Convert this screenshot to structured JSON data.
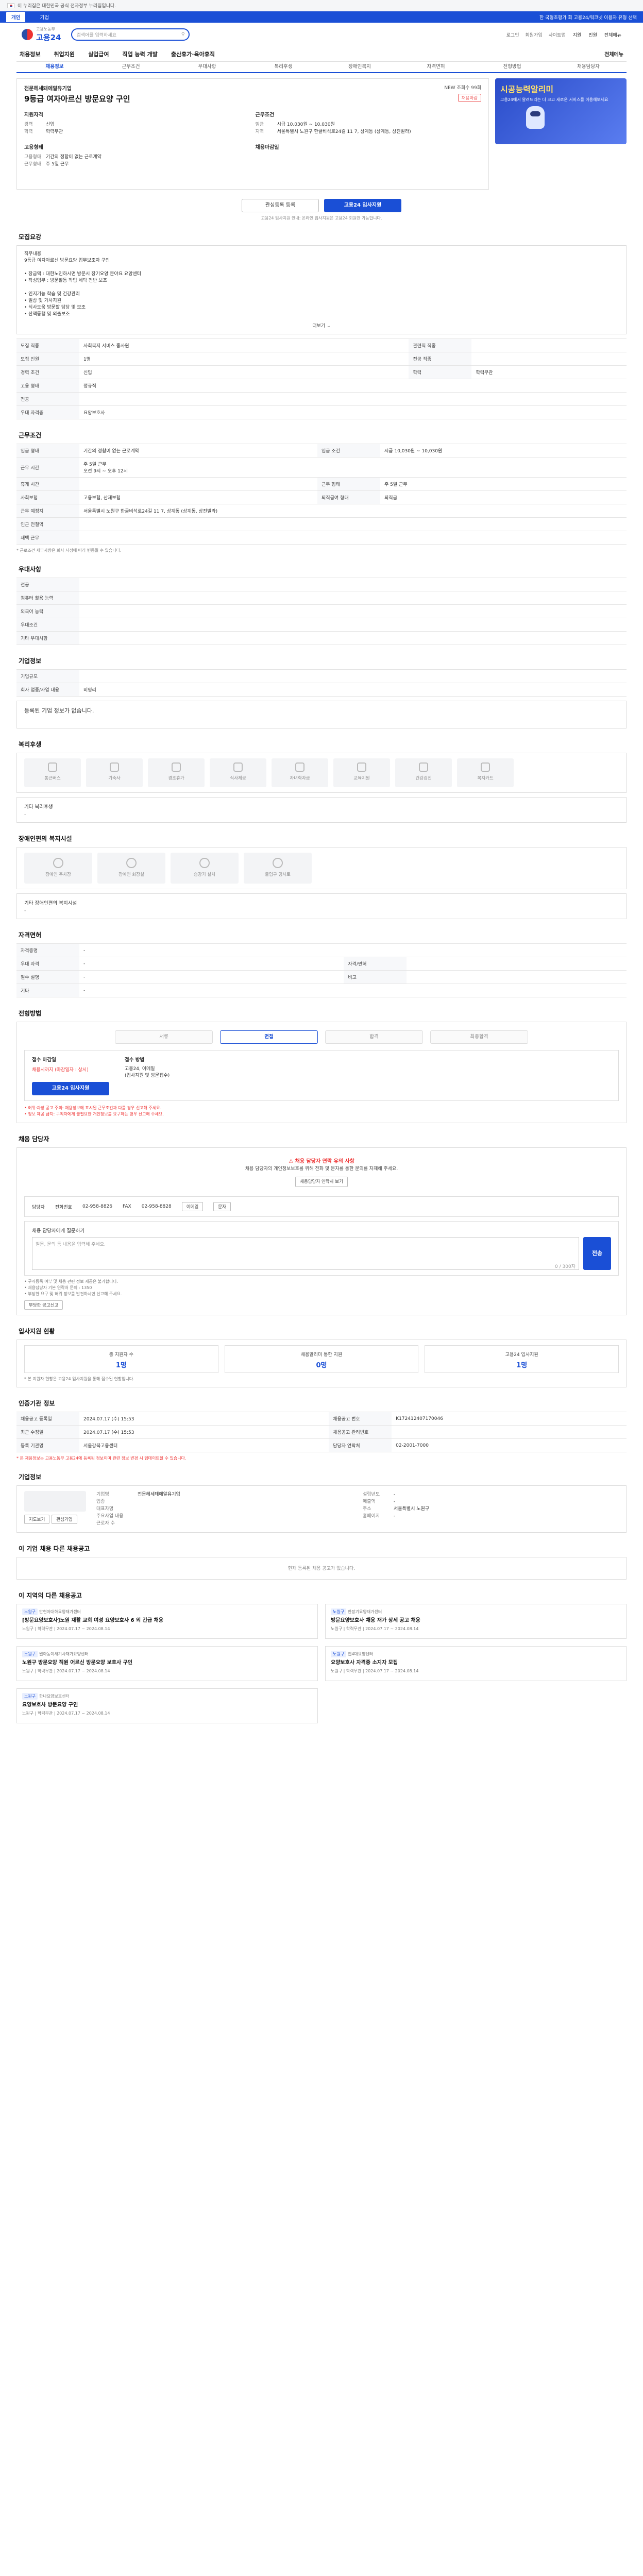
{
  "gov_notice": "이 누리집은 대한민국 공식 전자정부 누리집입니다.",
  "topnav": {
    "tab_personal": "개인",
    "tab_company": "기업",
    "right": "한 국형초평가 회 고용24/워크넷 이용자 유형 선택"
  },
  "header": {
    "logo": "고용24",
    "logo_sub": "고용노동부",
    "search_placeholder": "검색어를 입력하세요",
    "links": [
      "로그인",
      "회원가입",
      "사이트맵"
    ],
    "quick": [
      "지원",
      "민원",
      "전체메뉴"
    ]
  },
  "gnb": [
    "채용정보",
    "취업지원",
    "실업급여",
    "직업 능력 개발",
    "출산휴가·육아휴직"
  ],
  "gnb_all": "전체메뉴",
  "subtabs": [
    "채용정보",
    "근무조건",
    "우대사항",
    "복리후생",
    "장애인복지",
    "자격면허",
    "전형방법",
    "채용담당자"
  ],
  "job": {
    "company": "전문헤세돼에알유기업",
    "title": "9등급 여자아르신 방문요양 구인",
    "top_right": "NEW 조회수 99회",
    "badge": "채용마감",
    "left_head": "지원자격",
    "left": [
      {
        "k": "경력",
        "v": "신입"
      },
      {
        "k": "학력",
        "v": "학력무관"
      }
    ],
    "left_head2": "고용형태",
    "left2": [
      {
        "k": "고용형태",
        "v": "기간의 정함이 없는 근로계약"
      },
      {
        "k": "근무형태",
        "v": "주 5일 근무"
      }
    ],
    "right_head": "근무조건",
    "right": [
      {
        "k": "임금",
        "v": "시급 10,030원 ~ 10,030원"
      },
      {
        "k": "지역",
        "v": "서울특별시 노원구 한글비석로24길 11 7, 상계동 (상계동, 상진빌라)"
      }
    ],
    "right_head2": "채용마감일"
  },
  "banner": {
    "title": "시공능력알리미",
    "text": "고용24에서 알려드리는 더 크고 새로운 서비스를 이용해보세요"
  },
  "buttons": {
    "scrap": "관심등록 등록",
    "apply": "고용24 입사지원"
  },
  "button_note": "고용24 입사지원 안내: 온라인 입사지원은 고용24 회원만 가능합니다.",
  "sections": {
    "recruit": "모집요강",
    "conditions": "근무조건",
    "preference": "우대사항",
    "company_info": "기업정보",
    "welfare": "복리후생",
    "disability": "장애인편의 복지시설",
    "license": "자격면허",
    "selection": "전형방법",
    "contact": "채용 담당자",
    "applicant_status": "입사지원 현황",
    "recruit_info": "인증기관 정보",
    "company_detail": "기업정보",
    "other_jobs": "이 기업 채용 다른 채용공고",
    "nearby": "이 지역의 다른 채용공고"
  },
  "recruit_desc": "직무내용\n9등급 여자아르신 방문요양 업무보조자 구인\n\n• 장금액 : 대한노인하시면 방문시 장기요양 분야요 요양센터\n• 작성업무 : 방문활동 작업 세탁 전반 보조\n\n• 인지기능 학습 및 건강관리\n• 일상 및 가사지원\n• 식사도움 방문할 담당 및 보조\n• 산책동행 및 외출보조",
  "recruit_more": "더보기",
  "recruit_table": [
    {
      "k1": "모집 직종",
      "v1": "사회복지 서비스 종사원",
      "k2": "관련직 직종",
      "v2": ""
    },
    {
      "k1": "모집 인원",
      "v1": "1명",
      "k2": "전공 직종",
      "v2": ""
    },
    {
      "k1": "경력 조건",
      "v1": "신입",
      "k2": "학력",
      "v2": "학력무관"
    },
    {
      "k1": "고용 형태",
      "v1": "정규직",
      "k2": "",
      "v2": ""
    },
    {
      "k1": "전공",
      "v1": "",
      "k2": "",
      "v2": ""
    },
    {
      "k1": "우대 자격증",
      "v1": "요양보호사",
      "k2": "",
      "v2": ""
    }
  ],
  "conditions_table": [
    {
      "k1": "임금 형태",
      "v1": "기간의 정함이 없는 근로계약",
      "k2": "임금 조건",
      "v2": "시급 10,030원 ~ 10,030원"
    },
    {
      "k1": "근무 시간",
      "v1": "주 5일 근무\n오전 9시 ~ 오후 12시",
      "k2": "",
      "v2": ""
    },
    {
      "k1": "휴게 시간",
      "v1": "",
      "k2": "근무 형태",
      "v2": "주 5일 근무"
    },
    {
      "k1": "사회보험",
      "v1": "고용보험, 산재보험",
      "k2": "퇴직급여 형태",
      "v2": "퇴직금"
    },
    {
      "k1": "근무 예정지",
      "v1": "서울특별시 노원구 한글비석로24길 11 7, 상계동 (상계동, 상진빌라)",
      "k2": "",
      "v2": ""
    },
    {
      "k1": "인근 전철역",
      "v1": "",
      "k2": "",
      "v2": ""
    },
    {
      "k1": "재택 근무",
      "v1": "",
      "k2": "",
      "v2": ""
    }
  ],
  "conditions_note": "* 근로조건 세부사항은 회사 사정에 따라 변동될 수 있습니다.",
  "preference_table": [
    {
      "k": "전공",
      "v": ""
    },
    {
      "k": "컴퓨터 활용 능력",
      "v": ""
    },
    {
      "k": "외국어 능력",
      "v": ""
    },
    {
      "k": "우대조건",
      "v": ""
    },
    {
      "k": "기타 우대사항",
      "v": ""
    }
  ],
  "company_table": [
    {
      "k": "기업규모",
      "v": ""
    },
    {
      "k": "회사 업종/사업 내용",
      "v": "비영리"
    }
  ],
  "company_empty": "등록된 기업 정보가 없습니다.",
  "welfare_items": [
    "통근버스",
    "기숙사",
    "경조휴가",
    "식사제공",
    "자녀학자금",
    "교육지원",
    "건강검진",
    "복지카드"
  ],
  "welfare_other": "기타 복리후생",
  "welfare_other_val": "-",
  "disability_items": [
    "장애인 주차장",
    "장애인 화장실",
    "승강기 설치",
    "출입구 경사로"
  ],
  "disability_other": "기타 장애인편의 복지시설",
  "disability_other_val": "-",
  "license_table": [
    {
      "k1": "자격증명",
      "v1": "-",
      "k2": "",
      "v2": ""
    },
    {
      "k1": "우대 자격",
      "v1": "-",
      "k2": "자격/면허",
      "v2": ""
    },
    {
      "k1": "필수 설명",
      "v1": "-",
      "k2": "비고",
      "v2": ""
    },
    {
      "k1": "기타",
      "v1": "-",
      "k2": "",
      "v2": ""
    }
  ],
  "selection_steps": [
    "서류",
    "면접",
    "합격",
    "최종합격"
  ],
  "apply": {
    "period_label": "접수 마감일",
    "period_value": "채용시까지 (마감일자 : 상시)",
    "method_label": "접수 방법",
    "method_value": "고용24, 이메일\n(입사지원 및 방문접수)",
    "button": "고용24 입사지원"
  },
  "apply_notes": "• 허위·과장 공고 주의: 채용정보에 표시된 근무조건과 다를 경우 신고해 주세요.\n• 정보 제공 금지: 구직자에게 불필요한 개인정보를 요구하는 경우 신고해 주세요.",
  "contact": {
    "warn": "채용 담당자 연락 유의 사항",
    "text": "채용 담당자의 개인정보보호를 위해 전화 및 문자를 통한 문의를 자제해 주세요.",
    "check_btn": "채용담당자 연락처 보기",
    "name_label": "담당자",
    "name": "",
    "tel_label": "전화번호",
    "tel": "02-958-8826",
    "fax_label": "FAX",
    "fax": "02-958-8828",
    "email_btn": "이메일",
    "msg_btn": "문자",
    "textarea_label": "채용 담당자에게 질문하기",
    "placeholder": "질문, 문의 등 내용을 입력해 주세요.",
    "counter": "0 / 300자",
    "send": "전송"
  },
  "contact_notes": "• 구직등록 여부 및 채용 관련 정보 제공은 불가합니다.\n• 채용담당자 기본 연락처 문의 : 1350\n• 부당한 요구 및 허위 정보를 발견하시면 신고해 주세요.",
  "report_btn": "부당한 공고신고",
  "applicants": [
    {
      "label": "총 지원자 수",
      "value": "1명"
    },
    {
      "label": "채용알리미 통한 지원",
      "value": "0명"
    },
    {
      "label": "고용24 입사지원",
      "value": "1명"
    }
  ],
  "applicants_note": "* 본 지원자 현황은 고용24 입사지원을 통해 접수된 현황입니다.",
  "recruit_info_table": [
    {
      "k1": "채용공고 등록일",
      "v1": "2024.07.17 (수) 15:53",
      "k2": "채용공고 번호",
      "v2": "K172412407170046"
    },
    {
      "k1": "최근 수정일",
      "v1": "2024.07.17 (수) 15:53",
      "k2": "채용공고 관리번호",
      "v2": ""
    },
    {
      "k1": "등록 기관명",
      "v1": "서울강북고용센터",
      "k2": "담당자 연락처",
      "v2": "02-2001-7000"
    }
  ],
  "recruit_info_note": "* 본 채용정보는 고용노동부 고용24에 등록된 정보이며 관련 정보 변경 시 업데이트될 수 있습니다.",
  "company_detail": {
    "name_label": "기업명",
    "name": "전문헤세돼에알유기업",
    "rows": [
      {
        "k": "업종",
        "v": ""
      },
      {
        "k": "대표자명",
        "v": ""
      },
      {
        "k": "주요사업 내용",
        "v": ""
      },
      {
        "k": "근로자 수",
        "v": ""
      }
    ],
    "rows2": [
      {
        "k": "설립년도",
        "v": "-"
      },
      {
        "k": "매출액",
        "v": "-"
      },
      {
        "k": "주소",
        "v": "서울특별시 노원구"
      },
      {
        "k": "홈페이지",
        "v": "-"
      }
    ],
    "btn_map": "지도보기",
    "btn_follow": "관심기업"
  },
  "other_jobs_empty": "현재 등록된 채용 공고가 없습니다.",
  "nearby_jobs": [
    {
      "tag": "노원구",
      "company": "안현아대하요양재가센터",
      "title": "[방문요양보호사]노원 재활 교회 여성 요양보호사 6 외 긴급 채용",
      "meta": "노원구 | 학력무관 | 2024.07.17 ~ 2024.08.14"
    },
    {
      "tag": "노원구",
      "company": "한장기요양재가센터",
      "title": "방문요양보호사 채용 재가 상세 공고 채용",
      "meta": "노원구 | 학력무관 | 2024.07.17 ~ 2024.08.14"
    },
    {
      "tag": "노원구",
      "company": "웹아동이새기사재가요양센터",
      "title": "노원구 방문요양 직원 어르신 방문요양 보호사 구인",
      "meta": "노원구 | 학력무관 | 2024.07.17 ~ 2024.08.14"
    },
    {
      "tag": "노원구",
      "company": "웹4대요양센터",
      "title": "요양보호사 자격증 소지자 모집",
      "meta": "노원구 | 학력무관 | 2024.07.17 ~ 2024.08.14"
    },
    {
      "tag": "노원구",
      "company": "한나요양보호센터",
      "title": "요양보호사 방문요양 구인",
      "meta": "노원구 | 학력무관 | 2024.07.17 ~ 2024.08.14"
    }
  ],
  "colors": {
    "primary": "#1a4fd6",
    "danger": "#e33333",
    "border": "#dddddd"
  }
}
